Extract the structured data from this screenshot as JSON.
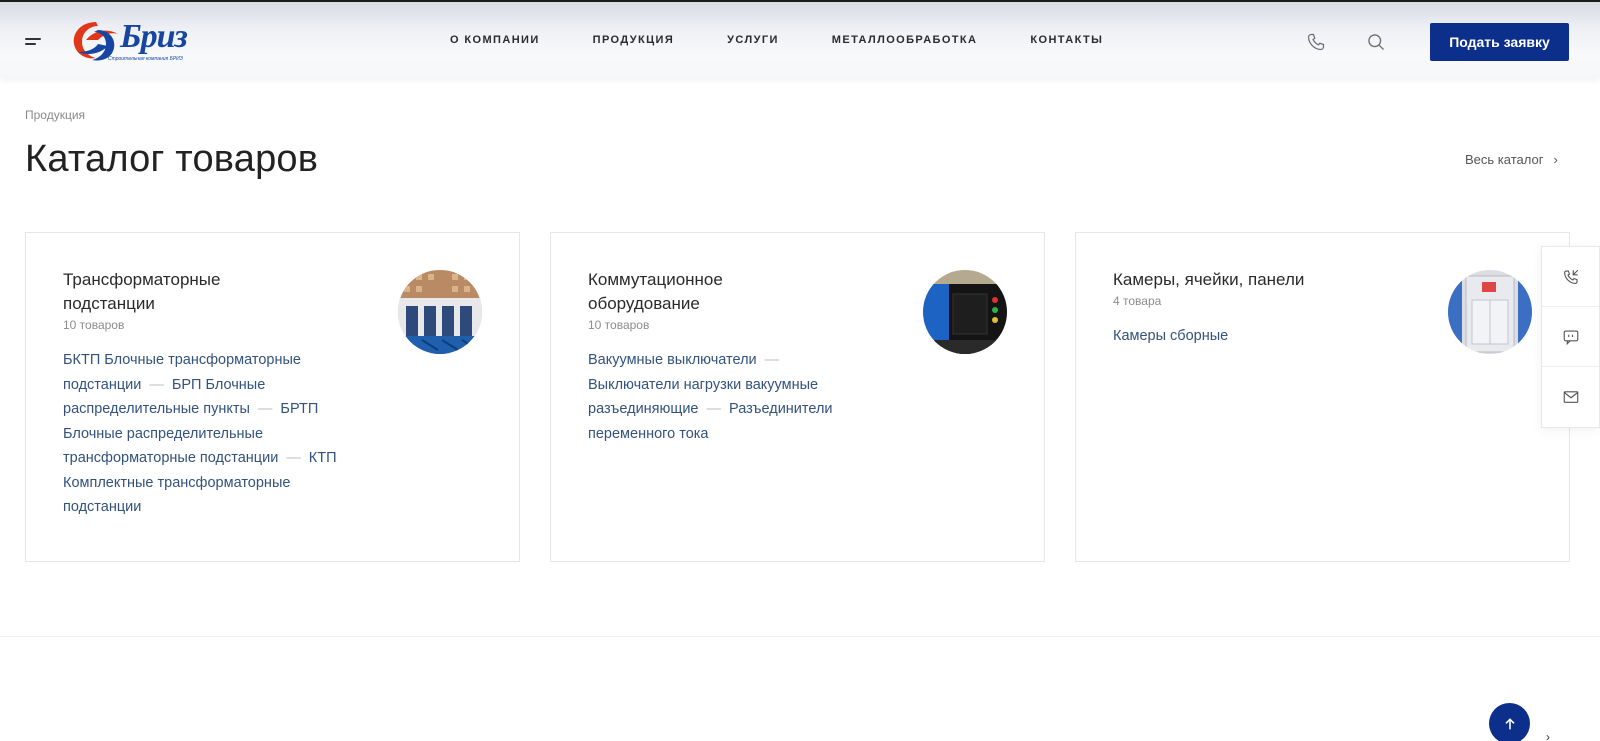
{
  "header": {
    "logo_text": "Бриз",
    "logo_sub": "Строительная компания БРИЗ",
    "nav": [
      "О КОМПАНИИ",
      "ПРОДУКЦИЯ",
      "УСЛУГИ",
      "МЕТАЛЛООБРАБОТКА",
      "КОНТАКТЫ"
    ],
    "request_button": "Подать заявку"
  },
  "breadcrumb": "Продукция",
  "page_title": "Каталог товаров",
  "all_catalog": "Весь каталог",
  "cards": [
    {
      "title": "Трансформаторные подстанции",
      "count": "10 товаров",
      "links": [
        "БКТП Блочные трансформаторные подстанции",
        "БРП Блочные распределительные пункты",
        "БРТП Блочные распределительные трансформаторные подстанции",
        "КТП Комплектные трансформаторные подстанции"
      ]
    },
    {
      "title": "Коммутационное оборудование",
      "count": "10 товаров",
      "links": [
        "Вакуумные выключатели",
        "Выключатели нагрузки вакуумные разъединяющие",
        "Разъединители переменного тока"
      ]
    },
    {
      "title": "Камеры, ячейки, панели",
      "count": "4 товара",
      "links": [
        "Камеры сборные"
      ]
    }
  ],
  "colors": {
    "brand": "#0c2f8c",
    "link": "#33527e",
    "logo_red": "#e0371b",
    "logo_blue": "#1746a2"
  },
  "icons": {
    "menu": "burger-menu-icon",
    "phone": "phone-icon",
    "search": "search-icon",
    "callback": "phone-callback-icon",
    "chat": "chat-icon",
    "mail": "mail-icon",
    "scroll_top": "arrow-up-icon",
    "chevron": "chevron-right-icon"
  }
}
